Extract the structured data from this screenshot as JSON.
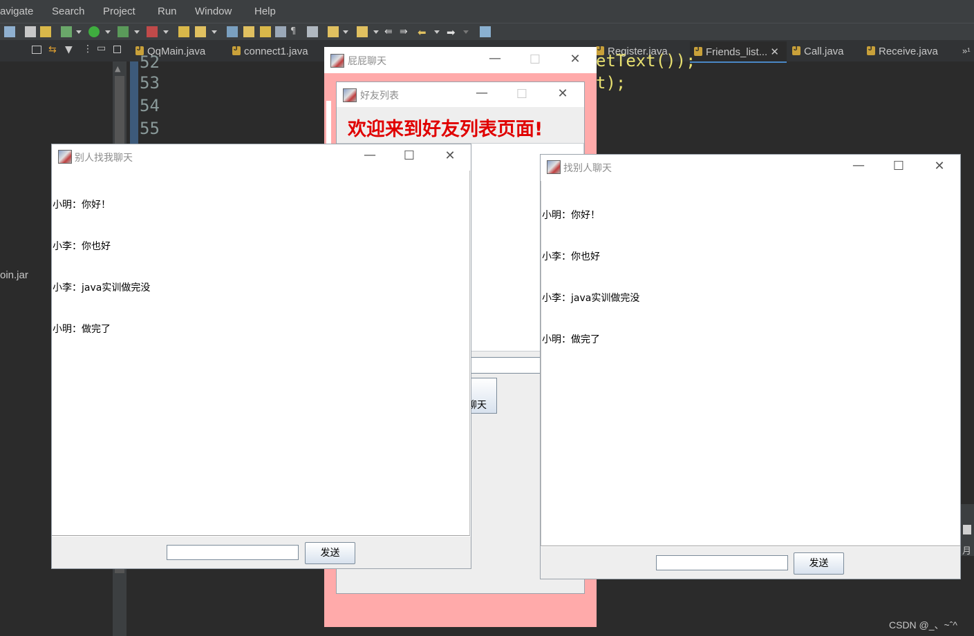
{
  "menu": [
    "avigate",
    "Search",
    "Project",
    "Run",
    "Window",
    "Help"
  ],
  "editor_tabs": [
    {
      "label": "QqMain.java"
    },
    {
      "label": "connect1.java"
    },
    {
      "label": "Register.java"
    },
    {
      "label": "Friends_list..."
    },
    {
      "label": "Call.java"
    },
    {
      "label": "Receive.java"
    }
  ],
  "tab_overflow": "»¹",
  "left_panel": {
    "jar_label": "oin.jar"
  },
  "line_numbers": [
    "52",
    "53",
    "54",
    "55"
  ],
  "code_fragments": [
    "etText());",
    "t);"
  ],
  "window_pipi": {
    "title": "屁屁聊天"
  },
  "window_friends": {
    "title": "好友列表",
    "welcome": "欢迎来到好友列表页面!",
    "partial_button": "聊天"
  },
  "window_others_find_me": {
    "title": "别人找我聊天",
    "messages": [
      "小明：你好！",
      "小李：你也好",
      "小李：java实训做完没",
      "小明：做完了"
    ],
    "input_value": "",
    "send_label": "发送"
  },
  "window_find_others": {
    "title": "找别人聊天",
    "messages": [
      "小明：你好！",
      "小李：你也好",
      "小李：java实训做完没",
      "小明：做完了"
    ],
    "input_value": "",
    "send_label": "发送"
  },
  "watermark": "CSDN @_、~ˆ^",
  "colors": {
    "pink_bg": "#ffaaaa",
    "welcome_red": "#e00000",
    "ide_bg": "#2b2b2b"
  }
}
